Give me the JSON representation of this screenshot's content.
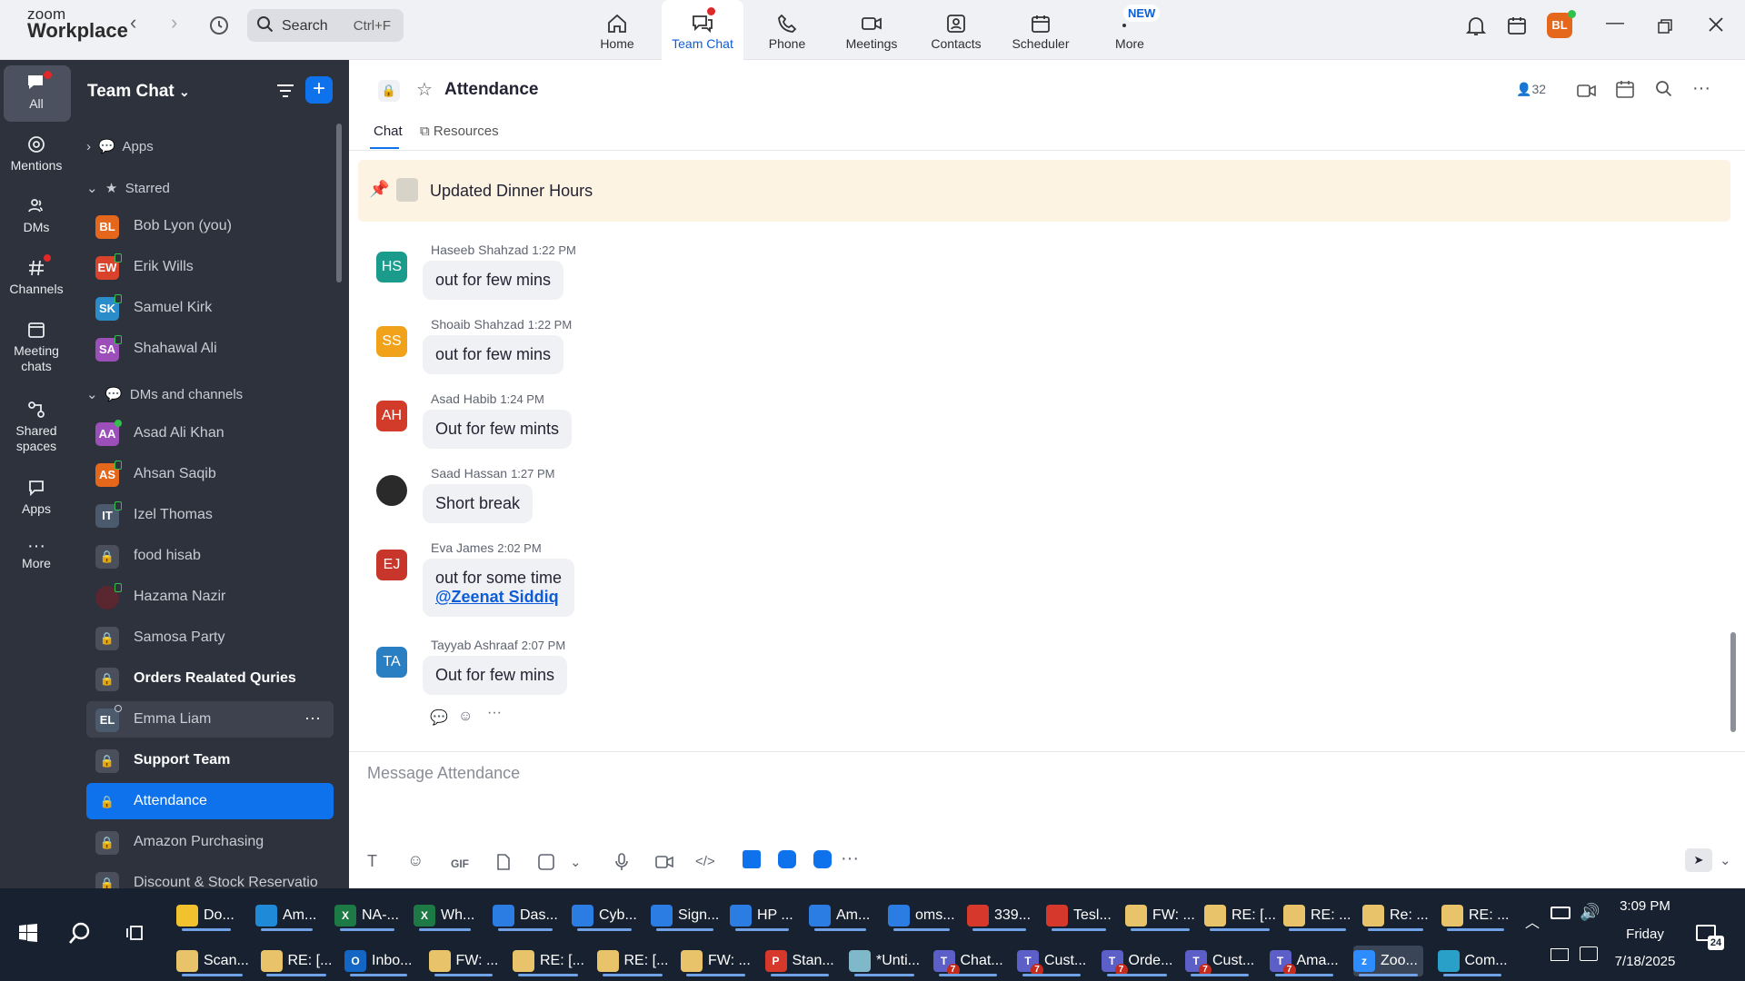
{
  "app": {
    "logo_top": "zoom",
    "logo_bottom": "Workplace"
  },
  "search": {
    "label": "Search",
    "shortcut": "Ctrl+F"
  },
  "topnav": [
    {
      "label": "Home"
    },
    {
      "label": "Team Chat"
    },
    {
      "label": "Phone"
    },
    {
      "label": "Meetings"
    },
    {
      "label": "Contacts"
    },
    {
      "label": "Scheduler"
    },
    {
      "label": "More",
      "badge": "NEW"
    }
  ],
  "user_initials": "BL",
  "rail": [
    {
      "label": "All"
    },
    {
      "label": "Mentions"
    },
    {
      "label": "DMs"
    },
    {
      "label": "Channels"
    },
    {
      "label": "Meeting chats"
    },
    {
      "label": "Shared spaces"
    },
    {
      "label": "Apps"
    },
    {
      "label": "More"
    }
  ],
  "sidebar": {
    "title": "Team Chat",
    "sections": {
      "apps": "Apps",
      "starred": "Starred",
      "dms": "DMs and channels"
    },
    "starred": [
      {
        "initials": "BL",
        "name": "Bob Lyon (you)",
        "color": "#e5671c"
      },
      {
        "initials": "EW",
        "name": "Erik Wills",
        "color": "#d9432c"
      },
      {
        "initials": "SK",
        "name": "Samuel Kirk",
        "color": "#2a8cc9"
      },
      {
        "initials": "SA",
        "name": "Shahawal Ali",
        "color": "#9c4fb8"
      }
    ],
    "channels": [
      {
        "initials": "AA",
        "name": "Asad Ali Khan",
        "color": "#9c4fb8"
      },
      {
        "initials": "AS",
        "name": "Ahsan Saqib",
        "color": "#e5671c"
      },
      {
        "initials": "IT",
        "name": "Izel Thomas",
        "color": "#4b5a6d"
      },
      {
        "initials": "",
        "name": "food hisab",
        "lock": true
      },
      {
        "initials": "",
        "name": "Hazama Nazir",
        "color": "#5a2630"
      },
      {
        "initials": "",
        "name": "Samosa Party",
        "lock": true
      },
      {
        "initials": "",
        "name": "Orders Realated Quries",
        "lock": true,
        "bold": true
      },
      {
        "initials": "EL",
        "name": "Emma Liam",
        "color": "#4b5a6d"
      },
      {
        "initials": "",
        "name": "Support Team",
        "lock": true,
        "bold": true
      },
      {
        "initials": "",
        "name": "Attendance",
        "lock": true,
        "selected": true
      },
      {
        "initials": "",
        "name": "Amazon Purchasing",
        "lock": true
      },
      {
        "initials": "",
        "name": "Discount & Stock Reservatio",
        "lock": true
      }
    ]
  },
  "channel": {
    "title": "Attendance",
    "members": "32",
    "tabs": [
      "Chat",
      "Resources"
    ],
    "pinned": "Updated Dinner Hours"
  },
  "messages": [
    {
      "initials": "HS",
      "sender": "Haseeb Shahzad",
      "time": "1:22 PM",
      "text": "out for few mins",
      "color": "#1a9b8c"
    },
    {
      "initials": "SS",
      "sender": "Shoaib Shahzad",
      "time": "1:22 PM",
      "text": "out for few mins",
      "color": "#f0a21a"
    },
    {
      "initials": "AH",
      "sender": "Asad Habib",
      "time": "1:24 PM",
      "text": "Out for few mints",
      "color": "#d23b2a"
    },
    {
      "initials": "",
      "sender": "Saad Hassan",
      "time": "1:27 PM",
      "text": "Short break",
      "color": "#2a2a2a"
    },
    {
      "initials": "EJ",
      "sender": "Eva James",
      "time": "2:02 PM",
      "text": "out for some time",
      "mention": "@Zeenat Siddiq",
      "color": "#c8352a"
    },
    {
      "initials": "TA",
      "sender": "Tayyab Ashraaf",
      "time": "2:07 PM",
      "text": "Out for few mins",
      "color": "#2a7fc2"
    }
  ],
  "composer": {
    "placeholder": "Message Attendance",
    "gif": "GIF"
  },
  "taskbar": {
    "row1": [
      {
        "label": "Do...",
        "color": "#f2c12e",
        "icon": ""
      },
      {
        "label": "Am...",
        "color": "#1f8ad8",
        "icon": ""
      },
      {
        "label": "NA-...",
        "color": "#1e7a45",
        "icon": "X"
      },
      {
        "label": "Wh...",
        "color": "#1e7a45",
        "icon": "X"
      },
      {
        "label": "Das...",
        "color": "#2c7de3",
        "icon": ""
      },
      {
        "label": "Cyb...",
        "color": "#2c7de3",
        "icon": ""
      },
      {
        "label": "Sign...",
        "color": "#2c7de3",
        "icon": ""
      },
      {
        "label": "HP ...",
        "color": "#2c7de3",
        "icon": ""
      },
      {
        "label": "Am...",
        "color": "#2c7de3",
        "icon": ""
      },
      {
        "label": "oms...",
        "color": "#2c7de3",
        "icon": ""
      },
      {
        "label": "339...",
        "color": "#d6392b",
        "icon": ""
      },
      {
        "label": "Tesl...",
        "color": "#d6392b",
        "icon": ""
      },
      {
        "label": "FW: ...",
        "color": "#e8c36a",
        "icon": ""
      },
      {
        "label": "RE: [...",
        "color": "#e8c36a",
        "icon": ""
      },
      {
        "label": "RE: ...",
        "color": "#e8c36a",
        "icon": ""
      },
      {
        "label": "Re: ...",
        "color": "#e8c36a",
        "icon": ""
      },
      {
        "label": "RE: ...",
        "color": "#e8c36a",
        "icon": ""
      }
    ],
    "row2": [
      {
        "label": "Scan...",
        "color": "#e8c36a",
        "icon": ""
      },
      {
        "label": "RE: [...",
        "color": "#e8c36a",
        "icon": ""
      },
      {
        "label": "Inbo...",
        "color": "#1466c4",
        "icon": "O"
      },
      {
        "label": "FW: ...",
        "color": "#e8c36a",
        "icon": ""
      },
      {
        "label": "RE: [...",
        "color": "#e8c36a",
        "icon": ""
      },
      {
        "label": "RE: [...",
        "color": "#e8c36a",
        "icon": ""
      },
      {
        "label": "FW: ...",
        "color": "#e8c36a",
        "icon": ""
      },
      {
        "label": "Stan...",
        "color": "#d6392b",
        "icon": "P"
      },
      {
        "label": "*Unti...",
        "color": "#7fb8c9",
        "icon": ""
      },
      {
        "label": "Chat...",
        "color": "#5b5fc7",
        "icon": "T",
        "badge": "7"
      },
      {
        "label": "Cust...",
        "color": "#5b5fc7",
        "icon": "T",
        "badge": "7"
      },
      {
        "label": "Orde...",
        "color": "#5b5fc7",
        "icon": "T",
        "badge": "7"
      },
      {
        "label": "Cust...",
        "color": "#5b5fc7",
        "icon": "T",
        "badge": "7"
      },
      {
        "label": "Ama...",
        "color": "#5b5fc7",
        "icon": "T",
        "badge": "7"
      },
      {
        "label": "Zoo...",
        "color": "#2d8cff",
        "icon": "z",
        "active": true
      },
      {
        "label": "Com...",
        "color": "#28a0c8",
        "icon": ""
      }
    ],
    "time": "3:09 PM",
    "day": "Friday",
    "date": "7/18/2025",
    "notif_count": "24"
  }
}
